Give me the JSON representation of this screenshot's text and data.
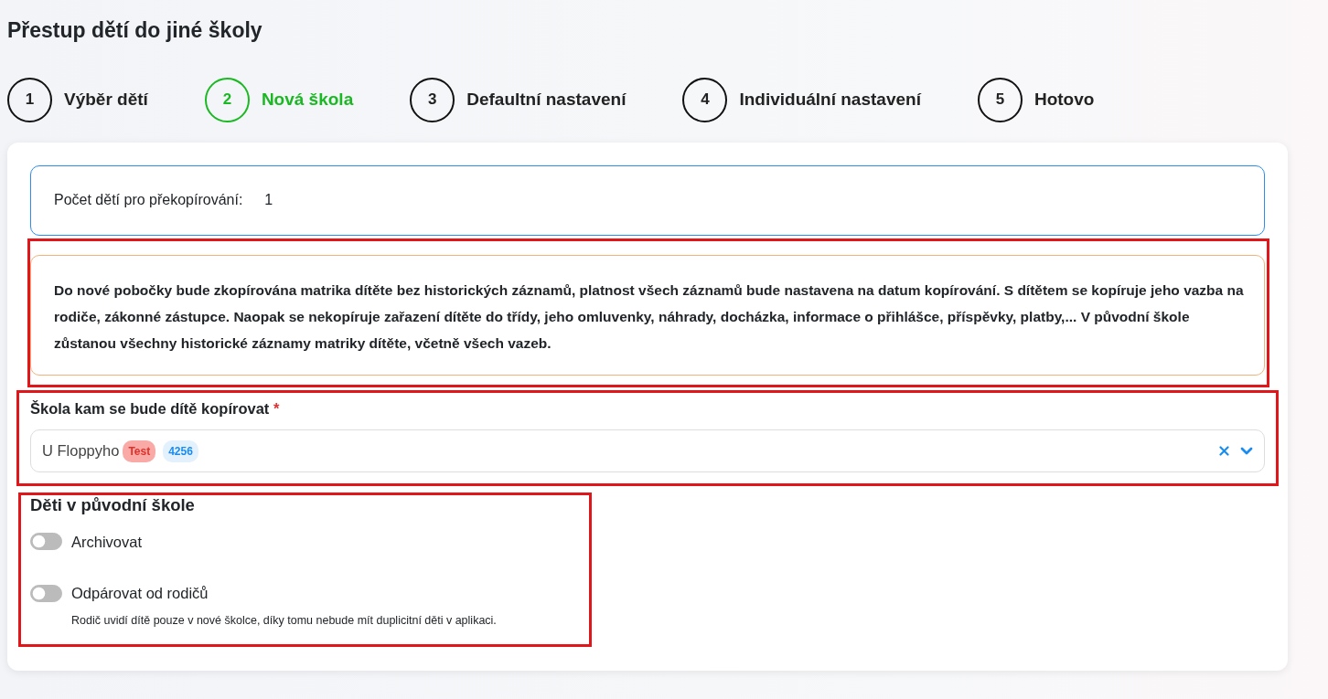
{
  "title": "Přestup dětí do jiné školy",
  "steps": [
    {
      "number": "1",
      "label": "Výběr dětí",
      "selected": false
    },
    {
      "number": "2",
      "label": "Nová škola",
      "selected": true
    },
    {
      "number": "3",
      "label": "Defaultní nastavení",
      "selected": false
    },
    {
      "number": "4",
      "label": "Individuální nastavení",
      "selected": false
    },
    {
      "number": "5",
      "label": "Hotovo",
      "selected": false
    }
  ],
  "count_info": {
    "label": "Počet dětí pro překopírování:",
    "value": "1"
  },
  "notice": {
    "highlighted": true,
    "text": "Do nové pobočky bude zkopírována matrika dítěte bez historických záznamů, platnost všech záznamů bude nastavena na datum kopírování. S dítětem se kopíruje jeho vazba na rodiče, zákonné zástupce. Naopak se nekopíruje zařazení dítěte do třídy, jeho omluvenky, náhrady, docházka, informace o přihlášce, příspěvky, platby,... V původní škole zůstanou všechny historické záznamy matriky dítěte, včetně všech vazeb."
  },
  "school_field": {
    "highlighted": true,
    "label": "Škola kam se bude dítě kopírovat",
    "required": true,
    "required_mark": "*",
    "value": "U Floppyho",
    "tags": [
      {
        "text": "Test",
        "kind": "warning"
      },
      {
        "text": "4256",
        "kind": "id"
      }
    ]
  },
  "original_school": {
    "highlighted": true,
    "title": "Děti v původní škole",
    "toggles": [
      {
        "label": "Archivovat",
        "on": false
      },
      {
        "label": "Odpárovat od rodičů",
        "on": false,
        "help": "Rodič uvidí dítě pouze v nové školce, díky tomu nebude mít duplicitní děti v aplikaci."
      }
    ]
  }
}
